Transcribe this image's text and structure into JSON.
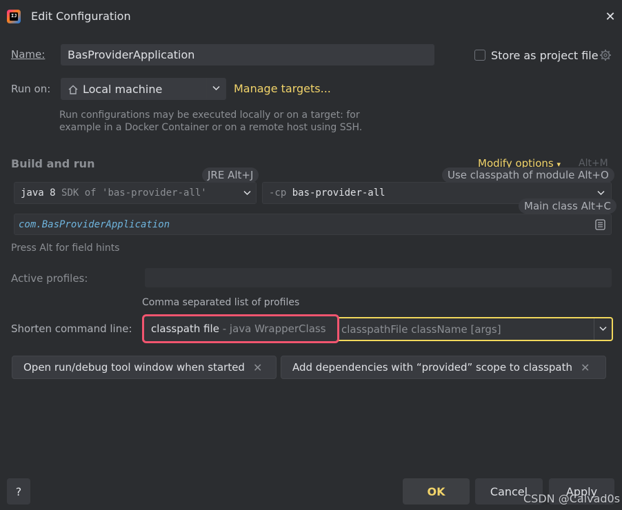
{
  "window": {
    "title": "Edit Configuration"
  },
  "name_row": {
    "label": "Name:",
    "value": "BasProviderApplication",
    "store_label": "Store as project file"
  },
  "run_on": {
    "label": "Run on:",
    "value": "Local machine",
    "manage_link": "Manage targets...",
    "description_line1": "Run configurations may be executed locally or on a target: for",
    "description_line2": "example in a Docker Container or on a remote host using SSH."
  },
  "build": {
    "title": "Build and run",
    "modify_options": "Modify options",
    "modify_shortcut": "Alt+M",
    "jre_hint": "JRE Alt+J",
    "classpath_hint": "Use classpath of module Alt+O",
    "main_class_hint": "Main class Alt+C",
    "jdk_value": "java 8",
    "jdk_suffix": "SDK of 'bas-provider-all'",
    "cp_prefix": "-cp",
    "cp_value": "bas-provider-all",
    "main_class": "com.BasProviderApplication",
    "field_hint": "Press Alt for field hints"
  },
  "profiles": {
    "label": "Active profiles:",
    "value": "",
    "hint": "Comma separated list of profiles"
  },
  "shorten": {
    "label": "Shorten command line:",
    "selected": "classpath file",
    "selected_suffix": " - java WrapperClass",
    "rest": "classpathFile className [args]"
  },
  "chips": [
    {
      "label": "Open run/debug tool window when started"
    },
    {
      "label": "Add dependencies with “provided” scope to classpath"
    }
  ],
  "footer": {
    "help": "?",
    "ok": "OK",
    "cancel": "Cancel",
    "apply": "Apply",
    "watermark": "CSDN @Calvad0s"
  },
  "colors": {
    "background": "#2b2d30",
    "accent_yellow": "#f2d46a",
    "highlight_red": "#f2556f",
    "highlight_yellow": "#f2d85c"
  }
}
